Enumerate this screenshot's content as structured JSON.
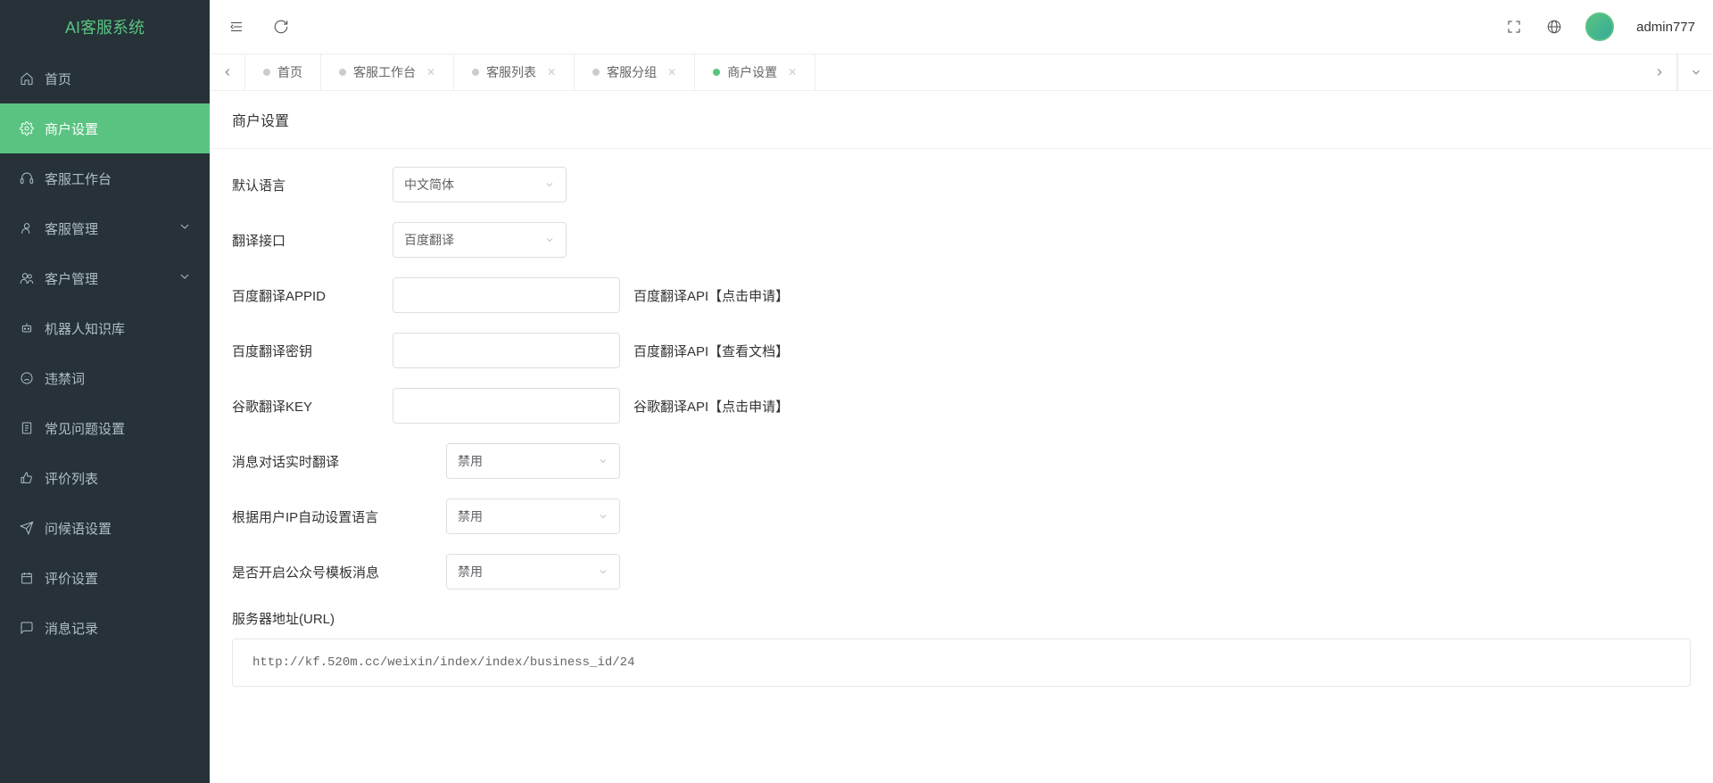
{
  "app": {
    "title": "AI客服系统"
  },
  "user": {
    "name": "admin777"
  },
  "sidebar": {
    "items": [
      {
        "label": "首页",
        "icon": "home"
      },
      {
        "label": "商户设置",
        "icon": "gear",
        "active": true
      },
      {
        "label": "客服工作台",
        "icon": "headset"
      },
      {
        "label": "客服管理",
        "icon": "user",
        "expandable": true
      },
      {
        "label": "客户管理",
        "icon": "users",
        "expandable": true
      },
      {
        "label": "机器人知识库",
        "icon": "robot"
      },
      {
        "label": "违禁词",
        "icon": "frown"
      },
      {
        "label": "常见问题设置",
        "icon": "doc"
      },
      {
        "label": "评价列表",
        "icon": "thumb"
      },
      {
        "label": "问候语设置",
        "icon": "send"
      },
      {
        "label": "评价设置",
        "icon": "calendar"
      },
      {
        "label": "消息记录",
        "icon": "msg"
      }
    ]
  },
  "tabs": [
    {
      "label": "首页",
      "closable": false
    },
    {
      "label": "客服工作台",
      "closable": true
    },
    {
      "label": "客服列表",
      "closable": true
    },
    {
      "label": "客服分组",
      "closable": true
    },
    {
      "label": "商户设置",
      "closable": true,
      "active": true
    }
  ],
  "page": {
    "title": "商户设置",
    "form": {
      "default_lang_label": "默认语言",
      "default_lang_value": "中文简体",
      "translate_api_label": "翻译接口",
      "translate_api_value": "百度翻译",
      "baidu_appid_label": "百度翻译APPID",
      "baidu_appid_value": "",
      "baidu_appid_hint": "百度翻译API【点击申请】",
      "baidu_secret_label": "百度翻译密钥",
      "baidu_secret_value": "",
      "baidu_secret_hint": "百度翻译API【查看文档】",
      "google_key_label": "谷歌翻译KEY",
      "google_key_value": "",
      "google_key_hint": "谷歌翻译API【点击申请】",
      "realtime_translate_label": "消息对话实时翻译",
      "realtime_translate_value": "禁用",
      "auto_lang_ip_label": "根据用户IP自动设置语言",
      "auto_lang_ip_value": "禁用",
      "wechat_template_label": "是否开启公众号模板消息",
      "wechat_template_value": "禁用",
      "server_url_label": "服务器地址(URL)",
      "server_url_value": "http://kf.520m.cc/weixin/index/index/business_id/24"
    }
  }
}
